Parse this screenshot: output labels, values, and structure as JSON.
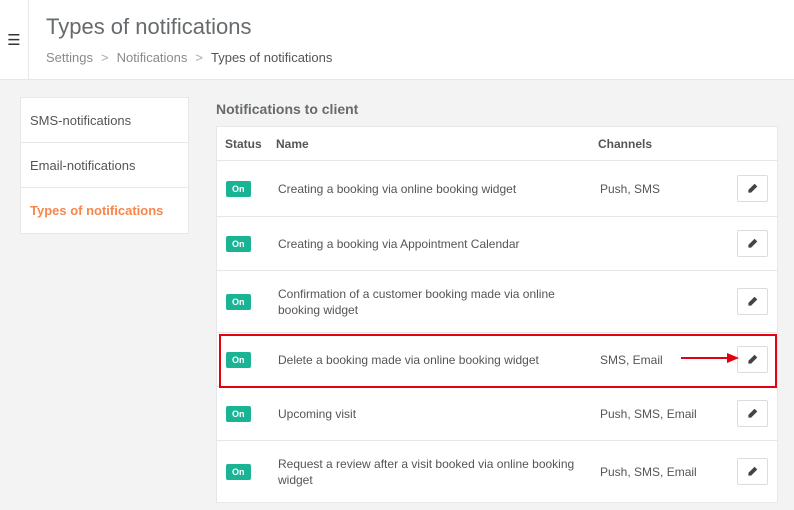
{
  "header": {
    "menu_icon": "hamburger-menu-icon",
    "title": "Types of notifications",
    "breadcrumb": [
      "Settings",
      "Notifications",
      "Types of notifications"
    ],
    "breadcrumb_separator": ">"
  },
  "sidebar": {
    "items": [
      {
        "label": "SMS-notifications",
        "active": false
      },
      {
        "label": "Email-notifications",
        "active": false
      },
      {
        "label": "Types of notifications",
        "active": true
      }
    ]
  },
  "section": {
    "title": "Notifications to client"
  },
  "table": {
    "columns": {
      "status": "Status",
      "name": "Name",
      "channels": "Channels"
    },
    "rows": [
      {
        "status": "On",
        "name": "Creating a booking via online booking widget",
        "channels": "Push, SMS"
      },
      {
        "status": "On",
        "name": "Creating a booking via Appointment Calendar",
        "channels": ""
      },
      {
        "status": "On",
        "name": "Confirmation of a customer booking made via online booking widget",
        "channels": ""
      },
      {
        "status": "On",
        "name": "Delete a booking made via online booking widget",
        "channels": "SMS, Email"
      },
      {
        "status": "On",
        "name": "Upcoming visit",
        "channels": "Push, SMS, Email"
      },
      {
        "status": "On",
        "name": "Request a review after a visit booked via online booking widget",
        "channels": "Push, SMS, Email"
      }
    ],
    "edit_icon": "pencil-icon"
  },
  "colors": {
    "accent": "#f7864d",
    "status_on": "#1ab394",
    "highlight": "#e3000f"
  }
}
